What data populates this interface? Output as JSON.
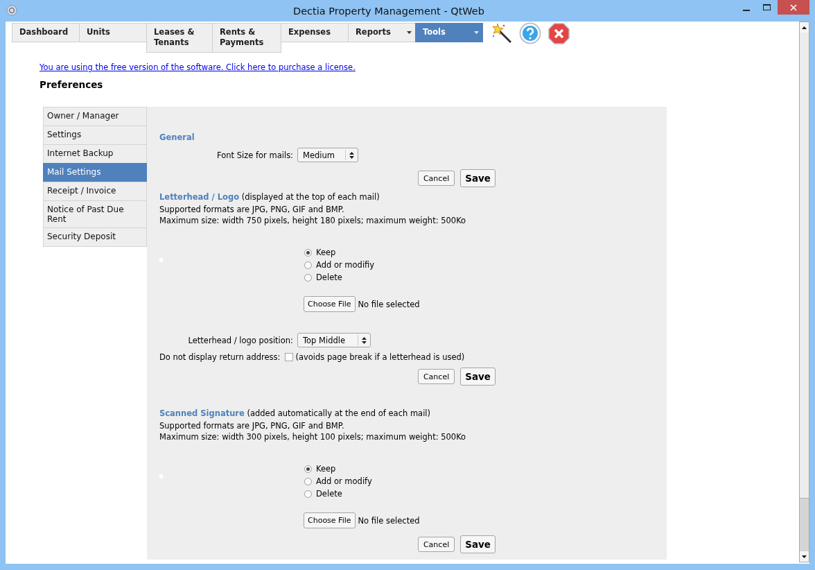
{
  "window": {
    "title": "Dectia Property Management - QtWeb"
  },
  "tabs": [
    {
      "label": "Dashboard",
      "selected": false,
      "dropdown": false
    },
    {
      "label": "Units",
      "selected": false,
      "dropdown": false
    },
    {
      "label": "Leases & Tenants",
      "selected": false,
      "dropdown": false
    },
    {
      "label": "Rents & Payments",
      "selected": false,
      "dropdown": false
    },
    {
      "label": "Expenses",
      "selected": false,
      "dropdown": false
    },
    {
      "label": "Reports",
      "selected": false,
      "dropdown": true
    },
    {
      "label": "Tools",
      "selected": true,
      "dropdown": true
    }
  ],
  "license_link": "You are using the free version of the software. Click here to purchase a license.",
  "page_title": "Preferences",
  "sidebar": {
    "items": [
      {
        "label": "Owner / Manager",
        "selected": false
      },
      {
        "label": "Settings",
        "selected": false
      },
      {
        "label": "Internet Backup",
        "selected": false
      },
      {
        "label": "Mail Settings",
        "selected": true
      },
      {
        "label": "Receipt / Invoice",
        "selected": false
      },
      {
        "label": "Notice of Past Due Rent",
        "selected": false
      },
      {
        "label": "Security Deposit",
        "selected": false
      }
    ]
  },
  "general": {
    "heading": "General",
    "font_size_label": "Font Size for mails:",
    "font_size_value": "Medium",
    "cancel": "Cancel",
    "save": "Save"
  },
  "letterhead": {
    "heading": "Letterhead / Logo",
    "note": "(displayed at the top of each mail)",
    "formats": "Supported formats are JPG, PNG, GIF and BMP.",
    "max_size": "Maximum size: width 750 pixels, height 180 pixels; maximum weight: 500Ko",
    "options": [
      {
        "label": "Keep",
        "selected": true
      },
      {
        "label": "Add or modifiy",
        "selected": false
      },
      {
        "label": "Delete",
        "selected": false
      }
    ],
    "choose_file": "Choose File",
    "file_status": "No file selected",
    "position_label": "Letterhead / logo position:",
    "position_value": "Top Middle",
    "return_address_label": "Do not display return address:",
    "return_address_checked": false,
    "return_address_note": "(avoids page break if a letterhead is used)",
    "cancel": "Cancel",
    "save": "Save"
  },
  "signature": {
    "heading": "Scanned Signature",
    "note": "(added automatically at the end of each mail)",
    "formats": "Supported formats are JPG, PNG, GIF and BMP.",
    "max_size": "Maximum size: width 300 pixels, height 100 pixels; maximum weight: 500Ko",
    "options": [
      {
        "label": "Keep",
        "selected": true
      },
      {
        "label": "Add or modify",
        "selected": false
      },
      {
        "label": "Delete",
        "selected": false
      }
    ],
    "choose_file": "Choose File",
    "file_status": "No file selected",
    "cancel": "Cancel",
    "save": "Save"
  }
}
